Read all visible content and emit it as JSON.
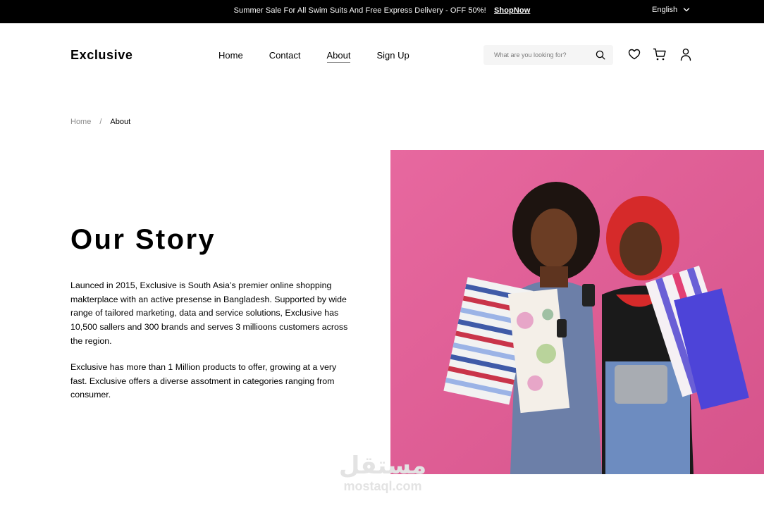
{
  "topbar": {
    "promo_text": "Summer Sale For All Swim Suits And Free Express Delivery - OFF 50%!",
    "shop_link": "ShopNow",
    "language": "English"
  },
  "header": {
    "logo": "Exclusive",
    "nav": [
      {
        "label": "Home"
      },
      {
        "label": "Contact"
      },
      {
        "label": "About",
        "active": true
      },
      {
        "label": "Sign Up"
      }
    ],
    "search_placeholder": "What are you looking for?",
    "icons": [
      "search-icon",
      "heart-icon",
      "cart-icon",
      "user-icon"
    ]
  },
  "breadcrumb": {
    "home": "Home",
    "separator": "/",
    "current": "About"
  },
  "story": {
    "title": "Our Story",
    "paragraph1": "Launced in 2015, Exclusive is South Asia’s premier online shopping makterplace with an active presense in Bangladesh. Supported by wide range of tailored marketing, data and service solutions, Exclusive has 10,500 sallers and 300 brands and serves 3 millioons customers across the region.",
    "paragraph2": "Exclusive has more than 1 Million products to offer, growing at a very fast. Exclusive offers a diverse assotment in categories ranging  from consumer."
  },
  "watermark": {
    "arabic": "مستقل",
    "latin": "mostaql.com"
  },
  "colors": {
    "topbar_bg": "#000000",
    "hero_bg": "#dc5a91",
    "search_bg": "#f5f5f5"
  }
}
